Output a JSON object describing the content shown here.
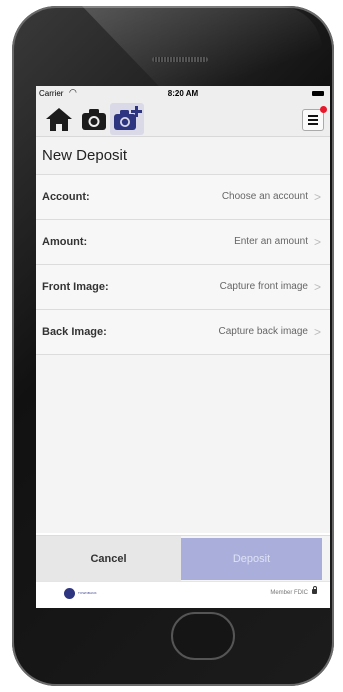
{
  "status_bar": {
    "carrier": "Carrier",
    "time": "8:20 AM"
  },
  "nav": {
    "icons": [
      "home-icon",
      "camera-icon",
      "camera-add-icon"
    ],
    "menu_icon": "menu-icon",
    "badge_color": "#e8172b"
  },
  "page_title": "New Deposit",
  "rows": [
    {
      "label": "Account:",
      "value": "Choose an account"
    },
    {
      "label": "Amount:",
      "value": "Enter an amount"
    },
    {
      "label": "Front Image:",
      "value": "Capture front image"
    },
    {
      "label": "Back Image:",
      "value": "Capture back image"
    }
  ],
  "chevron": ">",
  "buttons": {
    "cancel": "Cancel",
    "deposit": "Deposit"
  },
  "footer": {
    "brand_text": "TOWNBANK",
    "fdic": "Member FDIC"
  },
  "colors": {
    "accent": "#2d3580",
    "deposit_disabled": "#a9aedb"
  }
}
